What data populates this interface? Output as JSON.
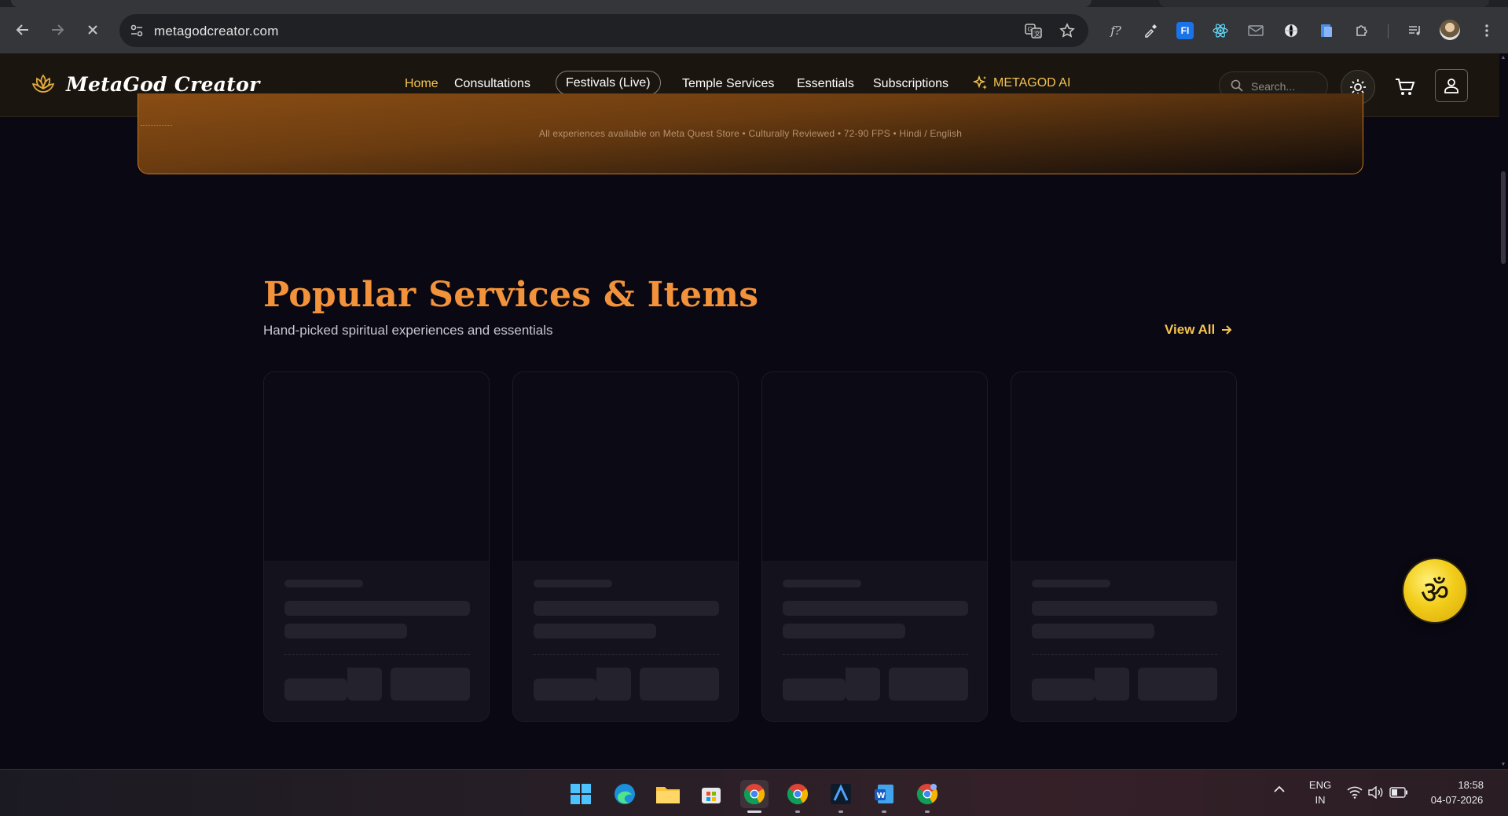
{
  "browser": {
    "url": "metagodcreator.com",
    "extensions": [
      "translate-icon",
      "star-icon",
      "font-finder-icon",
      "eyedropper-icon",
      "fi-extension-icon",
      "react-devtools-icon",
      "mail-icon",
      "globe-icon",
      "file-icon",
      "puzzle-icon",
      "media-queue-icon"
    ],
    "fi_badge": "FI"
  },
  "header": {
    "brand": "MetaGod Creator",
    "nav": {
      "home": "Home",
      "consultations": "Consultations",
      "festivals": "Festivals (Live)",
      "temple": "Temple Services",
      "essentials": "Essentials",
      "subscriptions": "Subscriptions",
      "ai": "METAGOD AI"
    },
    "search_placeholder": "Search...",
    "accent": "#f5c451"
  },
  "banner": {
    "disclaimer": "All experiences available on Meta Quest Store • Culturally Reviewed • 72-90 FPS • Hindi / English"
  },
  "section": {
    "title": "Popular Services & Items",
    "subtitle": "Hand-picked spiritual experiences and essentials",
    "view_all": "View All",
    "title_color": "#f2923a",
    "card_count": 4,
    "loading": true
  },
  "fab": {
    "glyph": "ॐ"
  },
  "taskbar": {
    "apps": [
      "windows-start-icon",
      "edge-icon",
      "file-explorer-icon",
      "microsoft-store-icon",
      "chrome-icon",
      "chrome-icon",
      "vector-app-icon",
      "word-icon",
      "chrome-profile-icon"
    ],
    "lang_top": "ENG",
    "lang_bottom": "IN",
    "time": "18:58",
    "date": "04-07-2026"
  }
}
